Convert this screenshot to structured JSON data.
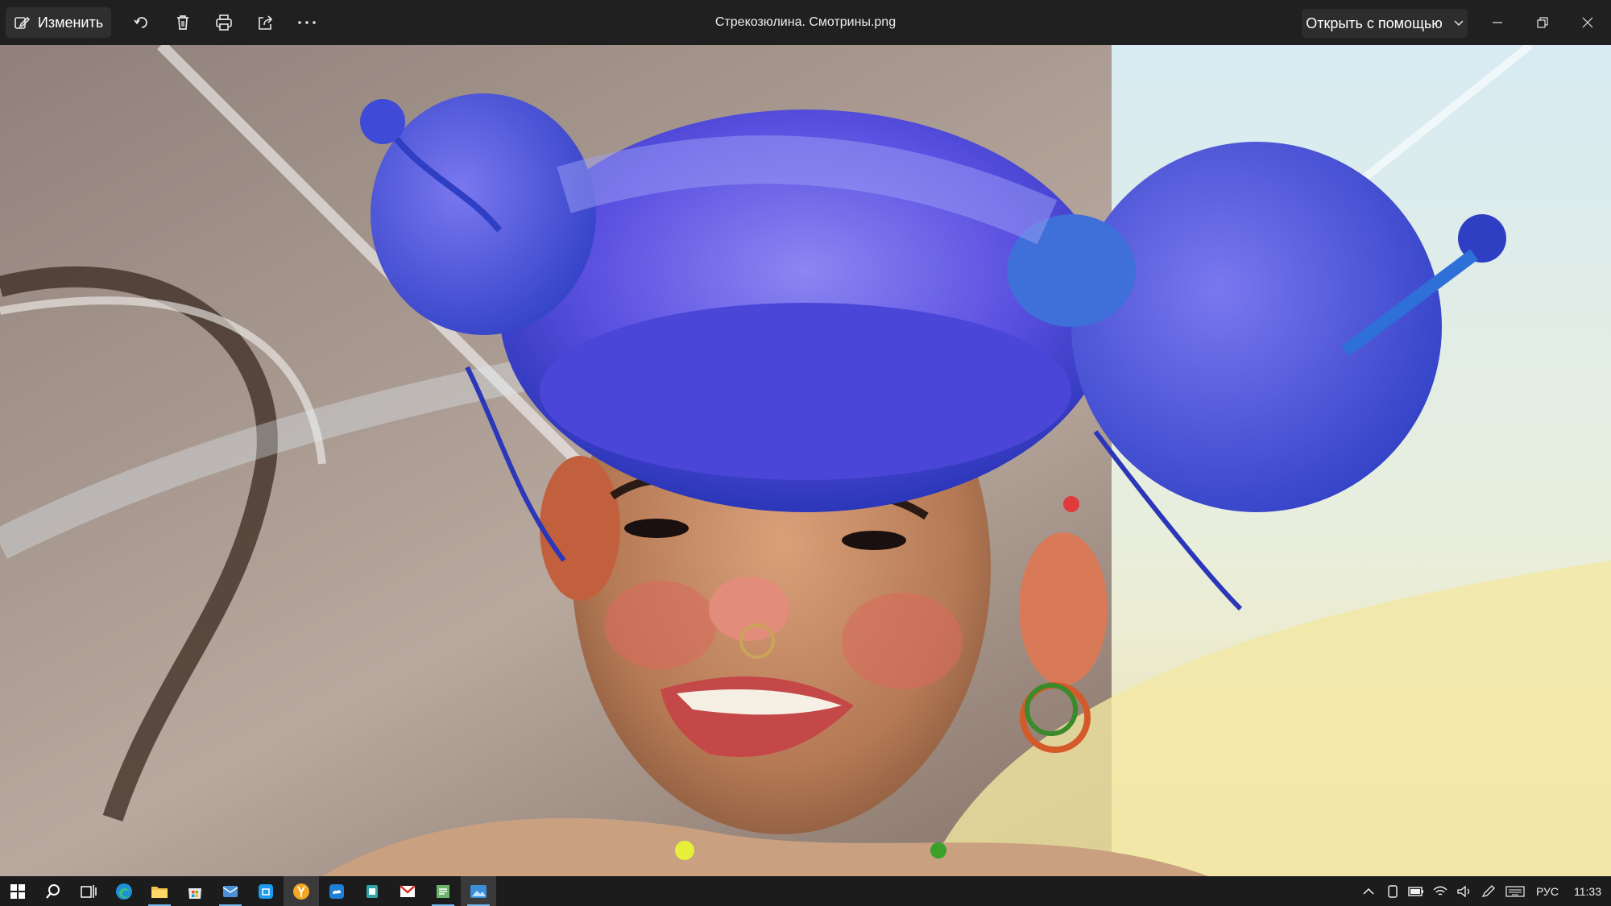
{
  "titlebar": {
    "edit_label": "Изменить",
    "file_name": "Стрекозюлина. Смотрины.png",
    "open_with_label": "Открыть с помощью",
    "icons": [
      "edit-icon",
      "rotate-icon",
      "delete-icon",
      "print-icon",
      "share-icon",
      "more-icon"
    ],
    "window_controls": [
      "minimize-icon",
      "restore-icon",
      "close-icon"
    ]
  },
  "viewer": {
    "image": "digital painting of a laughing girl with blue-violet hair in buns, nose ring and hoop earrings",
    "colors": {
      "hair": "#5a4fe0",
      "hair_dark": "#2b36b8",
      "skin": "#c98c62",
      "sky": "#cfe6f2",
      "bg_left": "#b5a49a",
      "accent_yellow": "#f3e7a2"
    }
  },
  "taskbar": {
    "apps": [
      "windows-start-icon",
      "search-icon",
      "task-view-icon",
      "edge-browser-icon",
      "file-explorer-icon",
      "microsoft-store-icon",
      "mail-client-icon",
      "app-store-icon",
      "yandex-browser-icon",
      "cloud-app-icon",
      "office-app-icon",
      "gmail-icon",
      "notes-app-icon",
      "photos-app-icon"
    ],
    "language": "РУС",
    "time": "11:33",
    "accent": "#76b9ed"
  }
}
